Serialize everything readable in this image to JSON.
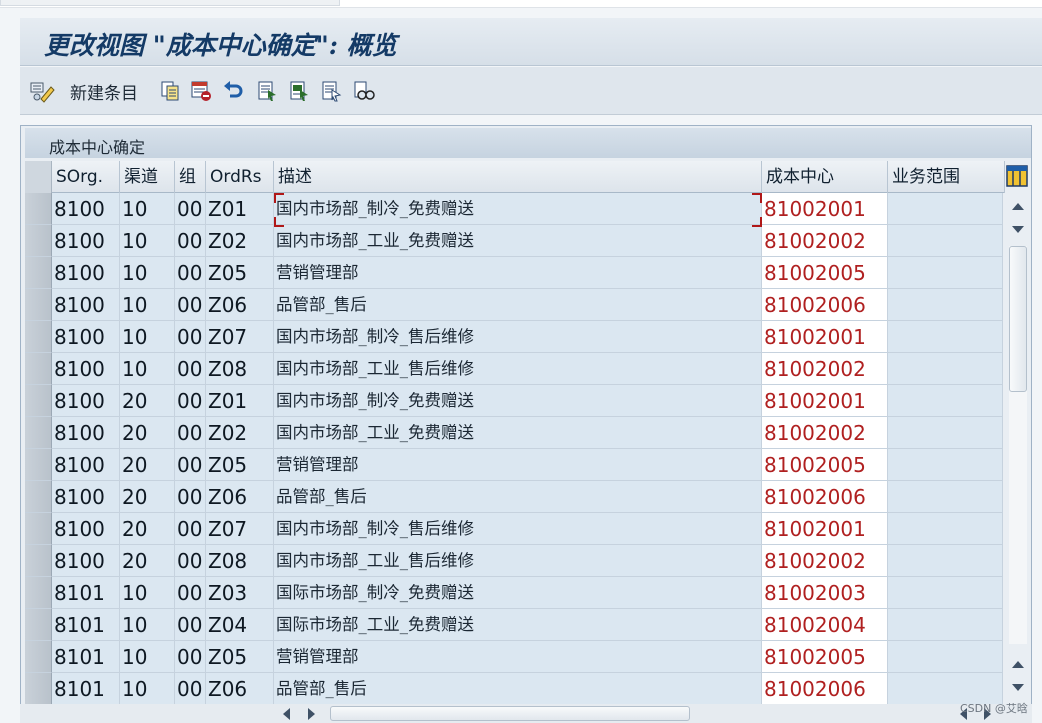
{
  "window": {
    "title": "更改视图 \"成本中心确定\": 概览"
  },
  "toolbar": {
    "new_entries_label": "新建条目",
    "icons": [
      "change-display-icon",
      "new-entries",
      "copy-as-icon",
      "delete-icon",
      "undo-icon",
      "select-all-icon",
      "select-block-icon",
      "deselect-all-icon",
      "find-icon"
    ]
  },
  "panel": {
    "title": "成本中心确定"
  },
  "table": {
    "columns": [
      "SOrg.",
      "渠道",
      "组",
      "OrdRs",
      "描述",
      "成本中心",
      "业务范围"
    ],
    "rows": [
      [
        "8100",
        "10",
        "00",
        "Z01",
        "国内市场部_制冷_免费赠送",
        "81002001",
        ""
      ],
      [
        "8100",
        "10",
        "00",
        "Z02",
        "国内市场部_工业_免费赠送",
        "81002002",
        ""
      ],
      [
        "8100",
        "10",
        "00",
        "Z05",
        "营销管理部",
        "81002005",
        ""
      ],
      [
        "8100",
        "10",
        "00",
        "Z06",
        "品管部_售后",
        "81002006",
        ""
      ],
      [
        "8100",
        "10",
        "00",
        "Z07",
        "国内市场部_制冷_售后维修",
        "81002001",
        ""
      ],
      [
        "8100",
        "10",
        "00",
        "Z08",
        "国内市场部_工业_售后维修",
        "81002002",
        ""
      ],
      [
        "8100",
        "20",
        "00",
        "Z01",
        "国内市场部_制冷_免费赠送",
        "81002001",
        ""
      ],
      [
        "8100",
        "20",
        "00",
        "Z02",
        "国内市场部_工业_免费赠送",
        "81002002",
        ""
      ],
      [
        "8100",
        "20",
        "00",
        "Z05",
        "营销管理部",
        "81002005",
        ""
      ],
      [
        "8100",
        "20",
        "00",
        "Z06",
        "品管部_售后",
        "81002006",
        ""
      ],
      [
        "8100",
        "20",
        "00",
        "Z07",
        "国内市场部_制冷_售后维修",
        "81002001",
        ""
      ],
      [
        "8100",
        "20",
        "00",
        "Z08",
        "国内市场部_工业_售后维修",
        "81002002",
        ""
      ],
      [
        "8101",
        "10",
        "00",
        "Z03",
        "国际市场部_制冷_免费赠送",
        "81002003",
        ""
      ],
      [
        "8101",
        "10",
        "00",
        "Z04",
        "国际市场部_工业_免费赠送",
        "81002004",
        ""
      ],
      [
        "8101",
        "10",
        "00",
        "Z05",
        "营销管理部",
        "81002005",
        ""
      ],
      [
        "8101",
        "10",
        "00",
        "Z06",
        "品管部_售后",
        "81002006",
        ""
      ]
    ]
  },
  "colors": {
    "cost_center_text": "#b02020",
    "title_text": "#143a66",
    "cell_background": "#dbe7f1"
  },
  "watermark": "CSDN @艾晗"
}
